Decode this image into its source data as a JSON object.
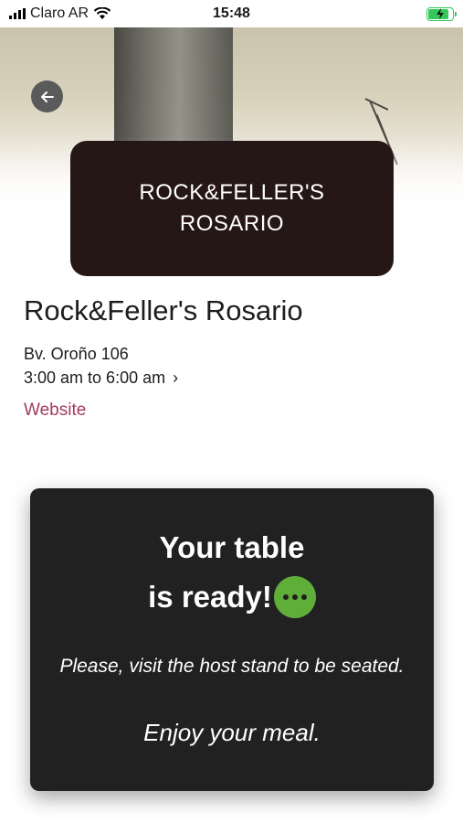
{
  "status_bar": {
    "carrier": "Claro AR",
    "time": "15:48",
    "battery_color": "#34c759"
  },
  "hero": {
    "back_icon": "arrow-left-icon"
  },
  "brand": {
    "logo_text": "ROCK&FELLER'S\nROSARIO",
    "background": "#251715"
  },
  "venue": {
    "name": "Rock&Feller's Rosario",
    "address": "Bv. Oroño 106",
    "hours": "3:00 am to 6:00 am",
    "hours_chevron": "›",
    "website_label": "Website",
    "link_color": "#a33a62"
  },
  "notification": {
    "title_line1": "Your table",
    "title_line2": "is ready!",
    "typing_icon": "typing-bubble-icon",
    "typing_icon_color": "#5fae3a",
    "instruction": "Please, visit the host stand to be seated.",
    "closing": "Enjoy your meal.",
    "background": "#212121"
  }
}
